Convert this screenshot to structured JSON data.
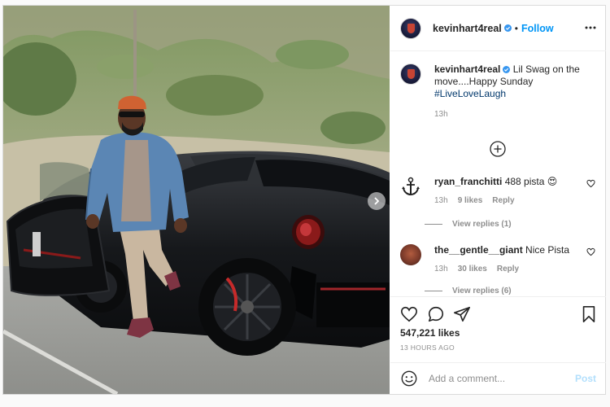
{
  "post": {
    "username": "kevinhart4real",
    "follow_label": "Follow",
    "separator": "•",
    "caption_text": "Lil Swag on the move....Happy Sunday",
    "caption_hashtag": "#LiveLoveLaugh",
    "caption_time": "13h",
    "likes": "547,221 likes",
    "posted_ago": "13 HOURS AGO"
  },
  "comments": [
    {
      "username": "ryan_franchitti",
      "text": "488 pista 😍",
      "time": "13h",
      "likes": "9 likes",
      "reply_label": "Reply",
      "view_replies": "View replies (1)"
    },
    {
      "username": "the__gentle__giant",
      "text": "Nice Pista",
      "time": "13h",
      "likes": "30 likes",
      "reply_label": "Reply",
      "view_replies": "View replies (6)"
    }
  ],
  "composer": {
    "placeholder": "Add a comment...",
    "post_label": "Post"
  },
  "icons": {
    "verified": "verified-badge-icon",
    "more": "more-options-icon",
    "load_more": "plus-circle-icon",
    "like": "heart-icon",
    "comment": "comment-bubble-icon",
    "share": "paper-plane-icon",
    "save": "bookmark-icon",
    "emoji": "smiley-icon",
    "next": "chevron-right-icon"
  },
  "colors": {
    "accent": "#0095f6",
    "verified": "#3897f0",
    "muted": "#8e8e8e",
    "post_disabled": "#b2dffc",
    "hashtag": "#00376b"
  }
}
